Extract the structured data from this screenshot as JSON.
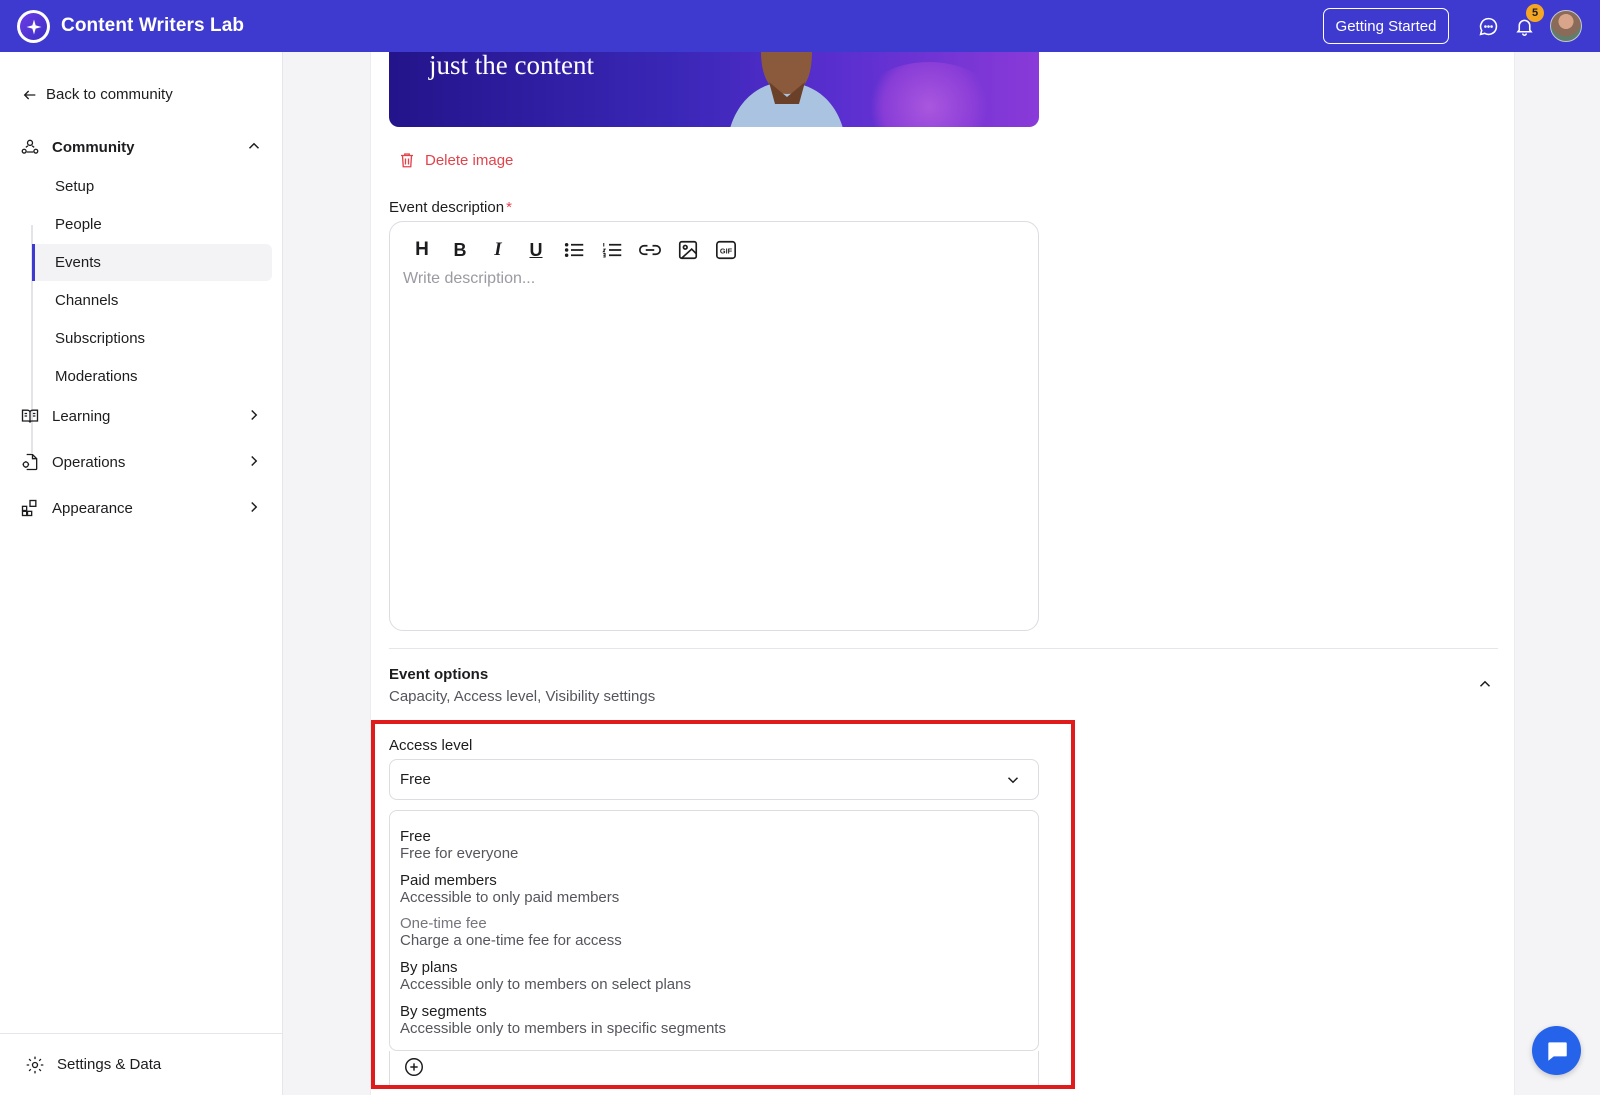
{
  "app": {
    "title": "Content Writers Lab"
  },
  "header": {
    "getting_started_label": "Getting Started",
    "notification_count": "5"
  },
  "sidebar": {
    "back_label": "Back to community",
    "community_label": "Community",
    "community_items": [
      {
        "label": "Setup"
      },
      {
        "label": "People"
      },
      {
        "label": "Events",
        "active": true
      },
      {
        "label": "Channels"
      },
      {
        "label": "Subscriptions"
      },
      {
        "label": "Moderations"
      }
    ],
    "groups": [
      {
        "label": "Learning"
      },
      {
        "label": "Operations"
      },
      {
        "label": "Appearance"
      }
    ],
    "settings_label": "Settings & Data"
  },
  "main": {
    "banner_text": "just the content",
    "delete_image_label": "Delete image",
    "description_label": "Event description",
    "required_mark": "*",
    "editor": {
      "heading_glyph": "H",
      "bold_glyph": "B",
      "italic_glyph": "I",
      "underline_glyph": "U",
      "placeholder": "Write description..."
    },
    "event_options": {
      "title": "Event options",
      "subtitle": "Capacity, Access level, Visibility settings"
    },
    "access_level": {
      "label": "Access level",
      "selected": "Free",
      "options": [
        {
          "title": "Free",
          "desc": "Free for everyone"
        },
        {
          "title": "Paid members",
          "desc": "Accessible to only paid members"
        },
        {
          "title": "One-time fee",
          "desc": "Charge a one-time fee for access",
          "muted": true
        },
        {
          "title": "By plans",
          "desc": "Accessible only to members on select plans"
        },
        {
          "title": "By segments",
          "desc": "Accessible only to members in specific segments"
        }
      ]
    }
  },
  "colors": {
    "brand": "#3f3acf",
    "danger": "#e2434b",
    "highlight": "#e01b1b",
    "fab": "#2563eb"
  }
}
